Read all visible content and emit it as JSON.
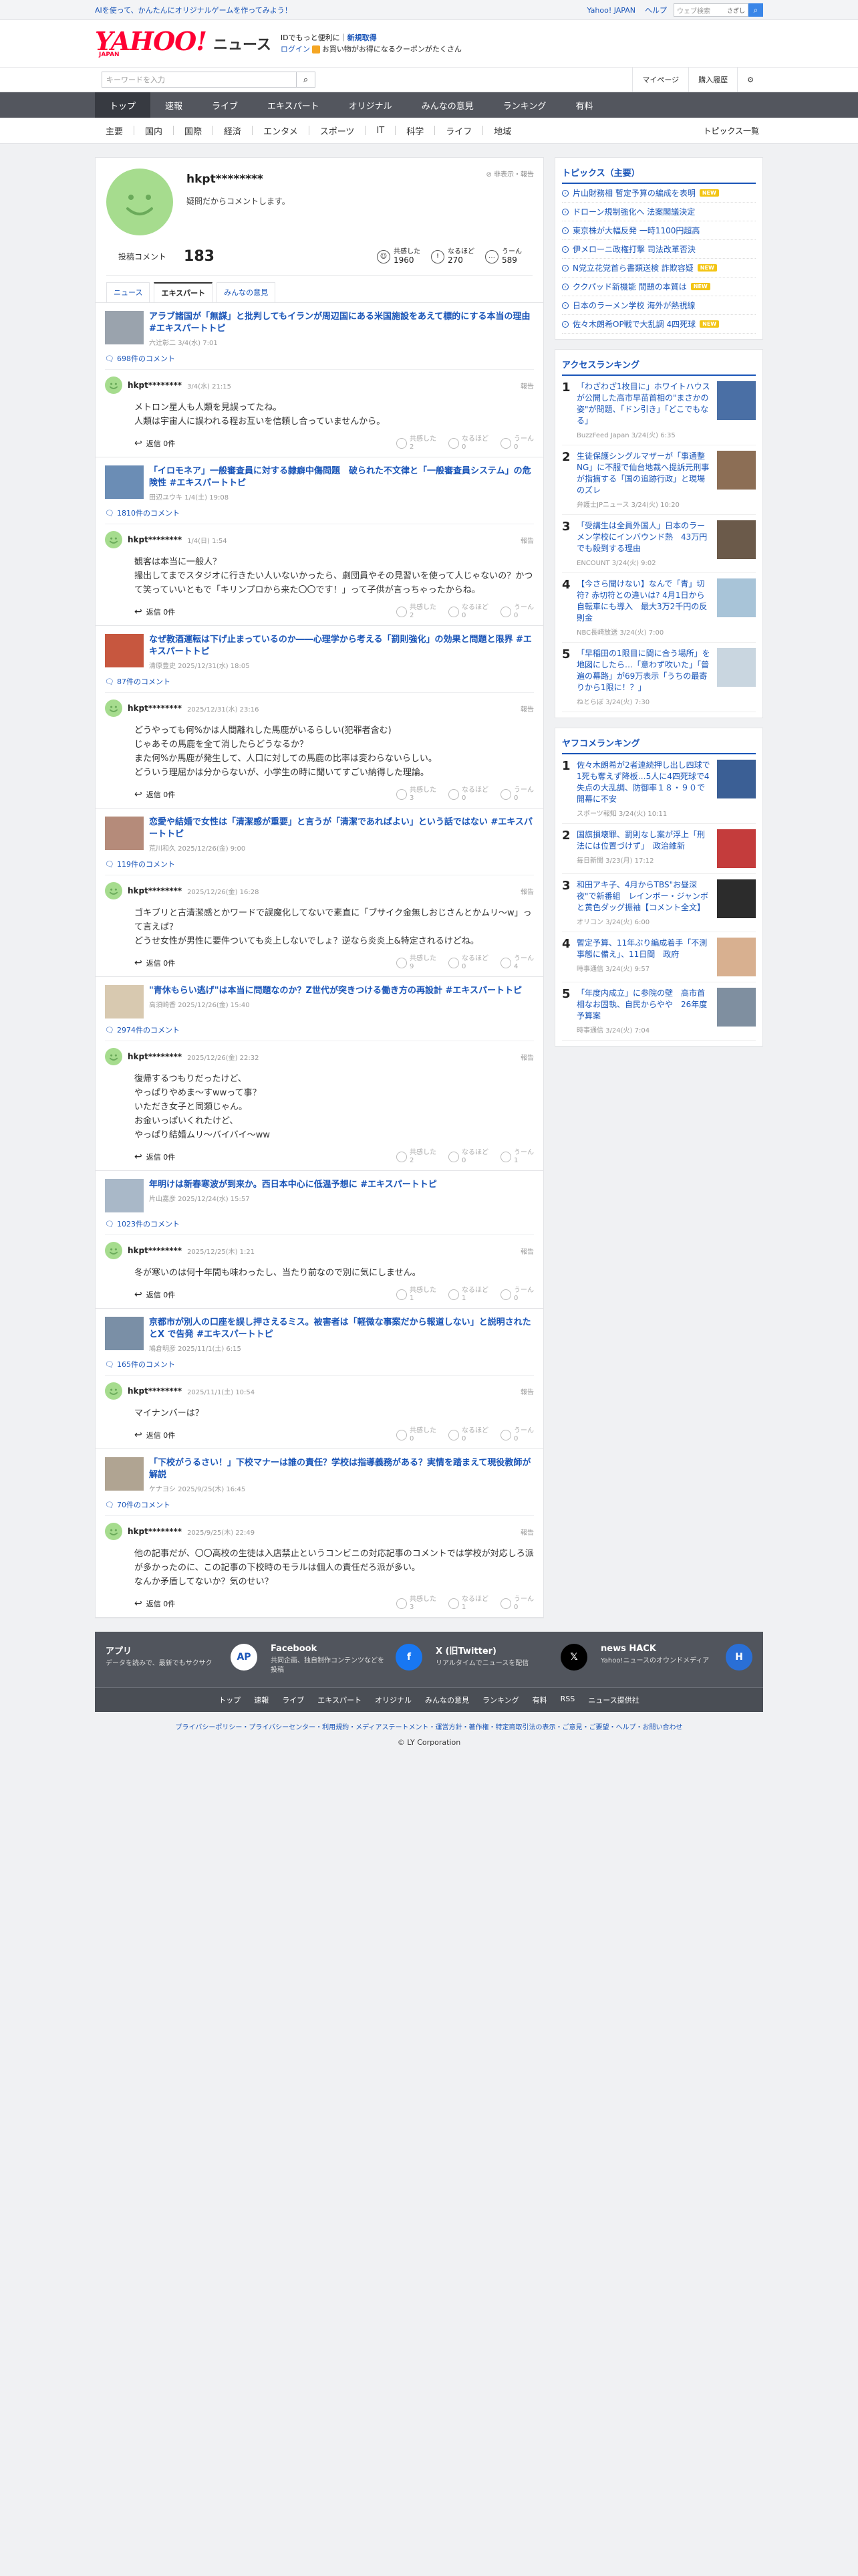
{
  "topbar": {
    "promo": "AIを使って、かんたんにオリジナルゲームを作ってみよう！",
    "links": [
      "Yahoo! JAPAN",
      "ヘルプ"
    ],
    "search_placeholder": "ウェブ検索",
    "search_btn": "さぎし"
  },
  "mast": {
    "logo": "YAHOO!",
    "logo_sub": "JAPAN",
    "news": "ニュース",
    "msg1a": "IDでもっと便利に",
    "msg1b": "新規取得",
    "msg2a": "ログイン",
    "msg2b": "お買い物がお得になるクーポンがたくさん"
  },
  "search": {
    "placeholder": "キーワードを入力",
    "mypage": "マイページ",
    "history": "購入履歴"
  },
  "nav": {
    "main": [
      "トップ",
      "速報",
      "ライブ",
      "エキスパート",
      "オリジナル",
      "みんなの意見",
      "ランキング",
      "有料"
    ],
    "sub": [
      "主要",
      "国内",
      "国際",
      "経済",
      "エンタメ",
      "スポーツ",
      "IT",
      "科学",
      "ライフ",
      "地域"
    ],
    "all": "トピックス一覧"
  },
  "profile": {
    "name": "hkpt********",
    "bio": "疑問だからコメントします。",
    "hide": "非表示・報告",
    "posts_label": "投稿コメント",
    "posts": "183",
    "reactions": [
      {
        "icon": "☺",
        "label": "共感した",
        "count": "1960"
      },
      {
        "icon": "!",
        "label": "なるほど",
        "count": "270"
      },
      {
        "icon": "…",
        "label": "うーん",
        "count": "589"
      }
    ],
    "tabs": [
      "ニュース",
      "エキスパート",
      "みんなの意見"
    ]
  },
  "common": {
    "reply": "返信 0件",
    "report": "報告",
    "r1": "共感した",
    "r2": "なるほど",
    "r3": "うーん"
  },
  "comments": [
    {
      "title": "アラブ諸国が「無謀」と批判してもイランが周辺国にある米国施設をあえて標的にする本当の理由 #エキスパートトピ",
      "src": "六辻彰二 3/4(水) 7:01",
      "count": "698件のコメント",
      "user": "hkpt********",
      "date": "3/4(水) 21:15",
      "body": "メトロン星人も人類を見誤ってたね。\n人類は宇宙人に誤われる程お互いを信頼し合っていませんから。",
      "r": [
        "2",
        "0",
        "0"
      ]
    },
    {
      "title": "「イロモネア」一般審査員に対する隷癖中傷問題　破られた不文律と「一般審査員システム」の危険性 #エキスパートトピ",
      "src": "田辺ユウキ 1/4(土) 19:08",
      "count": "1810件のコメント",
      "user": "hkpt********",
      "date": "1/4(日) 1:54",
      "body": "観客は本当に一般人？\n撮出してまでスタジオに行きたい人いないかったら、劇団員やその見習いを使って人じゃないの？かつて笑っていいともで「キリンプロから来た〇〇です！」って子供が言っちゃったからね。",
      "r": [
        "2",
        "0",
        "0"
      ]
    },
    {
      "title": "なぜ教酒運転は下げ止まっているのか――心理学から考える「罰則強化」の効果と問題と限界 #エキスパートトピ",
      "src": "清原豊史 2025/12/31(水) 18:05",
      "count": "87件のコメント",
      "user": "hkpt********",
      "date": "2025/12/31(水) 23:16",
      "body": "どうやっても何%かは人間離れした馬鹿がいるらしい(犯罪者含む)\nじゃあその馬鹿を全て消したらどうなるか？\nまた何%か馬鹿が発生して、人口に対しての馬鹿の比率は変わらないらしい。\nどういう理屈かは分からないが、小学生の時に聞いてすごい納得した理論。",
      "r": [
        "3",
        "0",
        "0"
      ]
    },
    {
      "title": "恋愛や結婚で女性は「清潔感が重要」と言うが「清潔であればよい」という話ではない #エキスパートトピ",
      "src": "荒川和久 2025/12/26(金) 9:00",
      "count": "119件のコメント",
      "user": "hkpt********",
      "date": "2025/12/26(金) 16:28",
      "body": "ゴキブリと古清潔感とかワードで誤魔化してないで素直に「ブサイク金無しおじさんとかムリ〜w」って言えば？\nどうせ女性が男性に要件ついても炎上しないでしょ？逆なら炎炎上&特定されるけどね。",
      "r": [
        "9",
        "0",
        "4"
      ]
    },
    {
      "title": "\"青休もらい逃げ\"は本当に問題なのか？Z世代が突きつける働き方の再設計 #エキスパートトピ",
      "src": "高須崎香 2025/12/26(金) 15:40",
      "count": "2974件のコメント",
      "user": "hkpt********",
      "date": "2025/12/26(金) 22:32",
      "body": "復帰するつもりだったけど、\nやっぱりやめま〜すwwって事？\nいただき女子と同類じゃん。\nお金いっぱいくれたけど、\nやっぱり結婚ムリ〜バイバイ〜ww",
      "r": [
        "2",
        "0",
        "1"
      ]
    },
    {
      "title": "年明けは新春寒波が到来か。西日本中心に低温予想に #エキスパートトピ",
      "src": "片山嘉彦 2025/12/24(水) 15:57",
      "count": "1023件のコメント",
      "user": "hkpt********",
      "date": "2025/12/25(木) 1:21",
      "body": "冬が寒いのは何十年間も味わったし、当たり前なので別に気にしません。",
      "r": [
        "1",
        "1",
        "0"
      ]
    },
    {
      "title": "京都市が別人の口座を誤し押さえるミス。被害者は「軽微な事案だから報道しない」と説明されたとX で告発 #エキスパートトピ",
      "src": "鳩倉明彦 2025/11/1(土) 6:15",
      "count": "165件のコメント",
      "user": "hkpt********",
      "date": "2025/11/1(土) 10:54",
      "body": "マイナンバーは？",
      "r": [
        "0",
        "0",
        "0"
      ]
    },
    {
      "title": "「下校がうるさい！」下校マナーは誰の責任？学校は指導義務がある？実情を踏まえて現役教師が解説",
      "src": "ケナヨシ 2025/9/25(木) 16:45",
      "count": "70件のコメント",
      "user": "hkpt********",
      "date": "2025/9/25(木) 22:49",
      "body": "他の記事だが、〇〇高校の生徒は入店禁止というコンビニの対応記事のコメントでは学校が対応しろ派が多かったのに、この記事の下校時のモラルは個人の責任だろ派が多い。\nなんか矛盾してないか？気のせい？",
      "r": [
        "3",
        "1",
        "0"
      ]
    }
  ],
  "side": {
    "topics_h": "トピックス（主要）",
    "topics": [
      {
        "t": "片山財務相 暫定予算の編成を表明",
        "b": "NEW"
      },
      {
        "t": "ドローン規制強化へ 法案閣議決定",
        "b": ""
      },
      {
        "t": "東京株が大幅反発 一時1100円超高",
        "b": ""
      },
      {
        "t": "伊メローニ政権打撃 司法改革否決",
        "b": ""
      },
      {
        "t": "N党立花党首ら書類送検 詐欺容疑",
        "b": "NEW"
      },
      {
        "t": "ククパッド新機能 問題の本質は",
        "b": "NEW"
      },
      {
        "t": "日本のラーメン学校 海外が熱視線",
        "b": ""
      },
      {
        "t": "佐々木朗希OP戦で大乱調 4四死球",
        "b": "NEW"
      }
    ],
    "access_h": "アクセスランキング",
    "access": [
      {
        "n": "1",
        "t": "「わざわざ1枚目に」ホワイトハウスが公開した高市早苗首相の\"まさかの姿\"が問題、「ドン引き」「どこでもなる」",
        "s": "BuzzFeed Japan 3/24(火) 6:35"
      },
      {
        "n": "2",
        "t": "生徒保護シングルマザーが「事通整NG」に不服で仙台地裁へ提訴元刑事が指摘する「国の追跡行政」と現場のズレ",
        "s": "弁護士JPニュース 3/24(火) 10:20"
      },
      {
        "n": "3",
        "t": "「受講生は全員外国人」日本のラーメン学校にインバウンド熱　43万円でも殺到する理由",
        "s": "ENCOUNT 3/24(火) 9:02"
      },
      {
        "n": "4",
        "t": "【今さら聞けない】なんで「青」切符? 赤切符との違いは? 4月1日から自転車にも導入　最大3万2千円の反則金",
        "s": "NBC長崎放送 3/24(火) 7:00"
      },
      {
        "n": "5",
        "t": "「早稲田の1限目に間に合う場所」を地図にしたら…「意わず吹いた」「普遍の幕路」が69万表示「うちの最寄りから1限に！？」",
        "s": "ねとらぼ 3/24(火) 7:30"
      }
    ],
    "yahoo_h": "ヤフコメランキング",
    "yahoo": [
      {
        "n": "1",
        "t": "佐々木朗希が2者連続押し出し四球で1死も奪えず降板…5人に4四死球で4失点の大乱調、防御率１８・９０で開幕に不安",
        "s": "スポーツ報知 3/24(火) 10:11"
      },
      {
        "n": "2",
        "t": "国旗損壊罪、罰則なし案が浮上「刑法には位置づけず」　政治維新",
        "s": "毎日新聞 3/23(月) 17:12"
      },
      {
        "n": "3",
        "t": "和田アキ子、4月からTBS\"お昼深夜\"で新番組　レインボー・ジャンボと黄色ダッグ振袖【コメント全文】",
        "s": "オリコン 3/24(火) 6:00"
      },
      {
        "n": "4",
        "t": "暫定予算、11年ぶり編成着手「不測事態に備え」、11日間　政府",
        "s": "時事通信 3/24(火) 9:57"
      },
      {
        "n": "5",
        "t": "「年度内成立」に参院の壁　高市首相なお固執、自民からやや　26年度予算案",
        "s": "時事通信 3/24(火) 7:04"
      }
    ]
  },
  "footer": {
    "apps": [
      {
        "t1": "アプリ",
        "t2": "データを読みで、最新でもサクサク",
        "lg": "AP"
      },
      {
        "t1": "Facebook",
        "t2": "共同企画、独自制作コンテンツなどを投稿",
        "lg": "f"
      },
      {
        "t1": "X (旧Twitter)",
        "t2": "リアルタイムでニュースを配信",
        "lg": "𝕏"
      },
      {
        "t1": "news HACK",
        "t2": "Yahoo!ニュースのオウンドメディア",
        "lg": "H"
      }
    ],
    "nav": [
      "トップ",
      "速報",
      "ライブ",
      "エキスパート",
      "オリジナル",
      "みんなの意見",
      "ランキング",
      "有料",
      "RSS",
      "ニュース提供社"
    ],
    "legal": "プライバシーポリシー・プライバシーセンター・利用規約・メディアステートメント・運営方針・著作権・特定商取引法の表示・ご意見・ご要望・ヘルプ・お問い合わせ",
    "copy": "© LY Corporation"
  }
}
